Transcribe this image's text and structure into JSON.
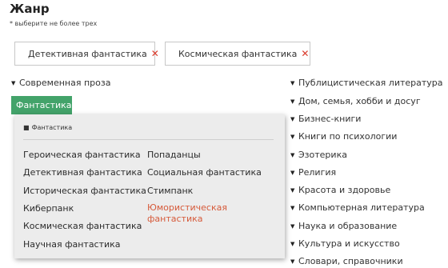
{
  "header": {
    "title": "Жанр",
    "hint": "* выберите не более трех"
  },
  "chips": [
    {
      "label": "Детективная фантастика",
      "remove": "✕"
    },
    {
      "label": "Космическая фантастика",
      "remove": "✕"
    }
  ],
  "left_tree": {
    "item": "Современная проза",
    "selected": "Фантастика"
  },
  "dropdown": {
    "breadcrumb": "Фантастика",
    "col1": [
      "Героическая фантастика",
      "Детективная фантастика",
      "Историческая фантастика",
      "Киберпанк",
      "Космическая фантастика",
      "Научная фантастика"
    ],
    "col2": [
      "Попаданцы",
      "Социальная фантастика",
      "Стимпанк",
      "Юмористическая фантастика"
    ]
  },
  "right_tree": [
    "Публицистическая литература",
    "Дом, семья, хобби и досуг",
    "Бизнес-книги",
    "Книги по психологии",
    "Эзотерика",
    "Религия",
    "Красота и здоровье",
    "Компьютерная литература",
    "Наука и образование",
    "Культура и искусство",
    "Словари, справочники"
  ],
  "colors": {
    "accent_green": "#43a36a",
    "remove_red": "#d93a2b",
    "highlight_orange": "#d65a3a"
  },
  "icons": {
    "tree_toggle": "triangle-down-icon",
    "home": "home-icon",
    "remove": "close-icon"
  }
}
